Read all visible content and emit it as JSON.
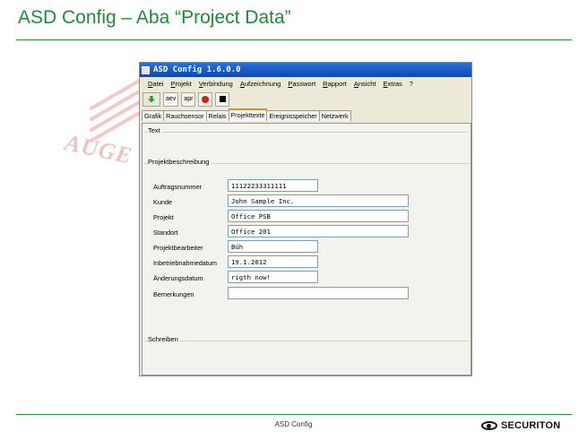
{
  "slide": {
    "title": "ASD Config – Aba “Project Data”",
    "footer": "ASD Config",
    "logo_text": "SECURITON",
    "watermark_text": "AUGE"
  },
  "colors": {
    "accent_green": "#1f8a3a",
    "titlebar_blue": "#0a49b5",
    "tab_highlight": "#e68b2c"
  },
  "window": {
    "title": "ASD Config 1.6.0.0",
    "menu": [
      "Datei",
      "Projekt",
      "Verbindung",
      "Aufzeichnung",
      "Passwort",
      "Rapport",
      "Ansicht",
      "Extras",
      "?"
    ],
    "toolbar": {
      "download_icon": "download-icon",
      "aev_label": "aev",
      "apr_label": "apr",
      "record_icon": "record-icon",
      "stop_icon": "stop-icon"
    },
    "tabs": [
      "Grafik",
      "Rauchsensor",
      "Relais",
      "Projekttexte",
      "Ereignisspeicher",
      "Netzwerk"
    ],
    "active_tab": "Projekttexte"
  },
  "panel": {
    "text_group": "Text",
    "project_group": "Projektbeschreibung",
    "write_group": "Schreiben",
    "fields": [
      {
        "label": "Auftragsnummer",
        "value": "11122233311111"
      },
      {
        "label": "Kunde",
        "value": "John Sample Inc."
      },
      {
        "label": "Projekt",
        "value": "Office PSB"
      },
      {
        "label": "Standort",
        "value": "Office 201"
      },
      {
        "label": "Projektbearbeiter",
        "value": "Büh"
      },
      {
        "label": "Inbetriebnahmedatum",
        "value": "19.1.2012"
      },
      {
        "label": "Änderungsdatum",
        "value": "rigth now!"
      },
      {
        "label": "Bemerkungen",
        "value": ""
      }
    ]
  }
}
